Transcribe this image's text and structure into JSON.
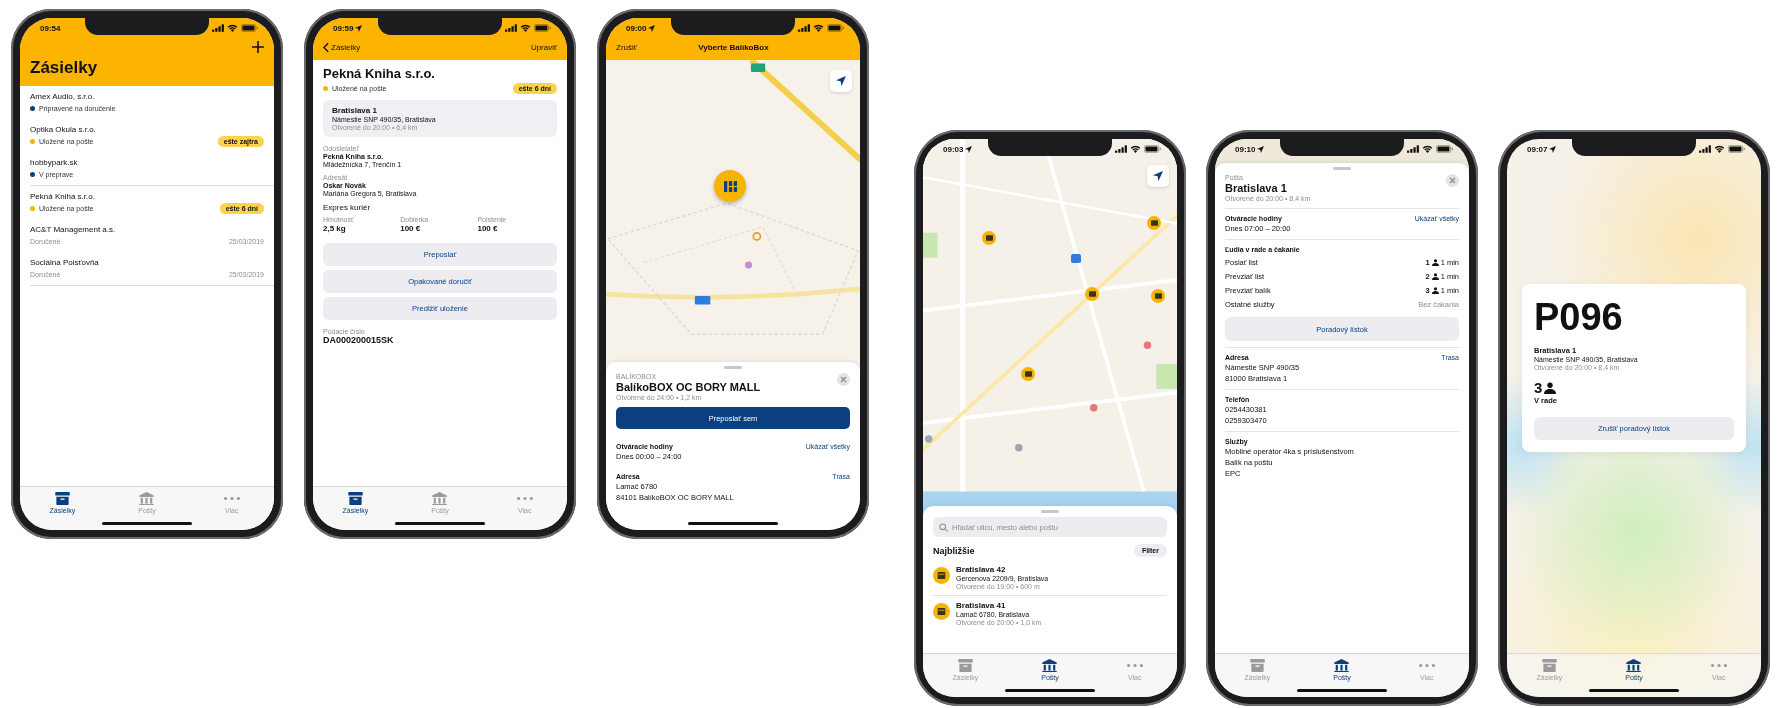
{
  "phone_groups": [
    {
      "phones": [
        {
          "kind": "shipment_list",
          "status_bar": {
            "time": "09:54"
          },
          "title": "Zásielky",
          "groups": [
            {
              "items": [
                {
                  "name": "Amex Audio, s.r.o.",
                  "status": "Pripravené na doručenie",
                  "color": "#0b3f7f"
                },
                {
                  "name": "Optika Okula s.r.o.",
                  "status": "Uložené na pošte",
                  "color": "#f5b400",
                  "badge": "ešte zajtra"
                },
                {
                  "name": "hobbypark.sk",
                  "status": "V preprave",
                  "color": "#0b3f7f"
                }
              ]
            },
            {
              "items": [
                {
                  "name": "Pekná Kniha s.r.o.",
                  "status": "Uložené na pošte",
                  "color": "#f5b400",
                  "badge": "ešte 6 dní"
                },
                {
                  "name": "AC&T Management a.s.",
                  "status": "Doručené",
                  "date": "25/03/2019"
                },
                {
                  "name": "Sociálna Poisťovňa",
                  "status": "Doručené",
                  "date": "25/03/2019"
                }
              ]
            }
          ],
          "tabs": [
            {
              "label": "Zásielky",
              "selected": true
            },
            {
              "label": "Pošty",
              "selected": false
            },
            {
              "label": "Viac",
              "selected": false
            }
          ]
        },
        {
          "kind": "shipment_detail",
          "status_bar": {
            "time": "09:59",
            "location": true
          },
          "nav": {
            "back": "Zásielky",
            "action": "Upraviť"
          },
          "title": "Pekná Kniha s.r.o.",
          "status": "Uložené na pošte",
          "color": "#f5b400",
          "badge": "ešte 6 dní",
          "place": {
            "name": "Bratislava 1",
            "address": "Námestie SNP 490/35, Bratislava",
            "hours": "Otvorené do 20:00 • 6,4 km"
          },
          "parties": [
            {
              "label": "Odosielateľ",
              "name": "Pekná Kniha s.r.o.",
              "address": "Mládežnícka 7, Trenčín 1"
            },
            {
              "label": "Adresát",
              "name": "Oskar Novák",
              "address": "Mariána Gregora 5, Bratislava"
            }
          ],
          "service": "Expres kuriér",
          "metrics": [
            {
              "label": "Hmotnosť",
              "value": "2,5 kg"
            },
            {
              "label": "Dobierka",
              "value": "100 €"
            },
            {
              "label": "Poistenie",
              "value": "100 €"
            }
          ],
          "buttons": [
            "Preposlať",
            "Opakované doručiť",
            "Predĺžiť uloženie"
          ],
          "tracking": {
            "label": "Podacie číslo",
            "value": "DA000200015SK"
          },
          "tabs": [
            {
              "label": "Zásielky",
              "selected": true
            },
            {
              "label": "Pošty",
              "selected": false
            },
            {
              "label": "Viac",
              "selected": false
            }
          ]
        },
        {
          "kind": "box_picker",
          "status_bar": {
            "time": "09:00",
            "location": true
          },
          "nav": {
            "cancel": "Zrušiť",
            "title": "Vyberte BalíkoBox"
          },
          "sheet": {
            "category": "BALÍKOBOX",
            "title": "BalíkoBOX OC BORY MALL",
            "hours": "Otvorené do 24:00 • 1,2 km",
            "primary": "Preposlať sem",
            "sections": [
              {
                "label": "Otváracie hodiny",
                "link": "Ukázať všetky",
                "lines": [
                  "Dnes 00:00 – 24:00"
                ]
              },
              {
                "label": "Adresa",
                "link": "Trasa",
                "lines": [
                  "Lamač 6780",
                  "84101 BalíkoBOX OC BORY MALL"
                ]
              }
            ]
          }
        }
      ]
    },
    {
      "phones": [
        {
          "kind": "post_map",
          "status_bar": {
            "time": "09:03",
            "location": true
          },
          "search": {
            "placeholder": "Hľadať ulicu, mesto alebo poštu"
          },
          "heading": "Najbližšie",
          "filter": "Filter",
          "posts": [
            {
              "name": "Bratislava 42",
              "address": "Gercenova 2209/9, Bratislava",
              "hours": "Otvorené do 19:00 • 600 m"
            },
            {
              "name": "Bratislava 41",
              "address": "Lamač 6780, Bratislava",
              "hours": "Otvorené do 20:00 • 1,0 km"
            }
          ],
          "tabs": [
            {
              "label": "Zásielky",
              "selected": false
            },
            {
              "label": "Pošty",
              "selected": true
            },
            {
              "label": "Viac",
              "selected": false
            }
          ]
        },
        {
          "kind": "post_detail",
          "status_bar": {
            "time": "09:10",
            "location": true
          },
          "category": "Pošta",
          "title": "Bratislava 1",
          "hours": "Otvorené do 20:00 • 8,4 km",
          "opening": {
            "label": "Otváracie hodiny",
            "link": "Ukázať všetky",
            "lines": [
              "Dnes 07:00 – 20:00"
            ]
          },
          "queue": {
            "label": "Ľudia v rade a čakanie",
            "rows": [
              {
                "kind": "count",
                "service": "Poslať list",
                "people": "1",
                "wait": "1 min"
              },
              {
                "kind": "count",
                "service": "Prevziať list",
                "people": "2",
                "wait": "1 min"
              },
              {
                "kind": "count",
                "service": "Prevziať balík",
                "people": "3",
                "wait": "1 min"
              },
              {
                "kind": "note",
                "service": "Ostatné služby",
                "note": "Bez čakania"
              }
            ]
          },
          "ticket_button": "Poradový lístok",
          "sections": [
            {
              "label": "Adresa",
              "link": "Trasa",
              "lines": [
                "Námestie SNP 490/35",
                "81000 Bratislava 1"
              ]
            },
            {
              "label": "Telefón",
              "lines": [
                "0254430381",
                "0259303470"
              ]
            },
            {
              "label": "Služby",
              "lines": [
                "Mobilné operátor 4ka s príslušenstvom",
                "Balík na poštu",
                "EPC"
              ]
            }
          ],
          "tabs": [
            {
              "label": "Zásielky",
              "selected": false
            },
            {
              "label": "Pošty",
              "selected": true
            },
            {
              "label": "Viac",
              "selected": false
            }
          ]
        },
        {
          "kind": "ticket",
          "status_bar": {
            "time": "09:07",
            "location": true
          },
          "ticket": {
            "number": "P096",
            "place": "Bratislava 1",
            "address": "Námestie SNP 490/35, Bratislava",
            "hours": "Otvorené do 20:00 • 8,4 km",
            "queue": "3",
            "queue_label": "V rade",
            "cancel": "Zrušiť poradový lístok"
          },
          "tabs": [
            {
              "label": "Zásielky",
              "selected": false
            },
            {
              "label": "Pošty",
              "selected": true
            },
            {
              "label": "Viac",
              "selected": false
            }
          ]
        }
      ]
    }
  ]
}
